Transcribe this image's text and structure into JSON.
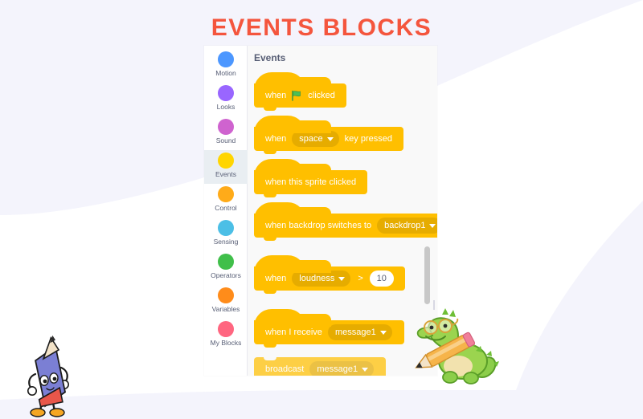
{
  "page": {
    "title": "EVENTS BLOCKS",
    "title_color": "#f4553d",
    "background_color": "#f4f4fc",
    "wave_color": "#ffffff"
  },
  "palette": {
    "header": "Events",
    "selected_category": "Events",
    "accent_color": "#ffbf00",
    "accent_dark_color": "#e6ac00",
    "categories": [
      {
        "label": "Motion",
        "color": "#4c97ff",
        "icon": "motion-dot-icon"
      },
      {
        "label": "Looks",
        "color": "#9966ff",
        "icon": "looks-dot-icon"
      },
      {
        "label": "Sound",
        "color": "#cf63cf",
        "icon": "sound-dot-icon"
      },
      {
        "label": "Events",
        "color": "#ffd500",
        "icon": "events-dot-icon"
      },
      {
        "label": "Control",
        "color": "#ffab19",
        "icon": "control-dot-icon"
      },
      {
        "label": "Sensing",
        "color": "#4cbfe6",
        "icon": "sensing-dot-icon"
      },
      {
        "label": "Operators",
        "color": "#40bf4a",
        "icon": "operators-dot-icon"
      },
      {
        "label": "Variables",
        "color": "#ff8c1a",
        "icon": "variables-dot-icon"
      },
      {
        "label": "My Blocks",
        "color": "#ff6680",
        "icon": "my-blocks-dot-icon"
      }
    ],
    "scrollbar": {
      "name": "vertical-scrollbar",
      "color": "#c8c8c8"
    }
  },
  "blocks": [
    {
      "id": "when-flag-clicked",
      "shape": "hat",
      "text_before": "when",
      "flag_icon": "green-flag-icon",
      "text_after": "clicked"
    },
    {
      "id": "when-key-pressed",
      "shape": "hat",
      "text_before": "when",
      "dropdown_value": "space",
      "text_after": "key pressed"
    },
    {
      "id": "when-this-sprite-clicked",
      "shape": "hat",
      "text_before": "when this sprite clicked"
    },
    {
      "id": "when-backdrop-switches-to",
      "shape": "hat",
      "text_before": "when backdrop switches to",
      "dropdown_value": "backdrop1"
    },
    {
      "id": "when-greater-than",
      "shape": "hat",
      "text_before": "when",
      "dropdown_value": "loudness",
      "operator": ">",
      "number_value": "10"
    },
    {
      "id": "when-i-receive",
      "shape": "hat",
      "text_before": "when I receive",
      "dropdown_value": "message1"
    },
    {
      "id": "broadcast",
      "shape": "stack",
      "text_before": "broadcast",
      "dropdown_value": "message1"
    }
  ],
  "mascots": [
    {
      "name": "pencil-character",
      "description": "blue pencil character with face, arms and orange shoes"
    },
    {
      "name": "dragon-character",
      "description": "green dragon wearing glasses riding a pencil"
    }
  ]
}
